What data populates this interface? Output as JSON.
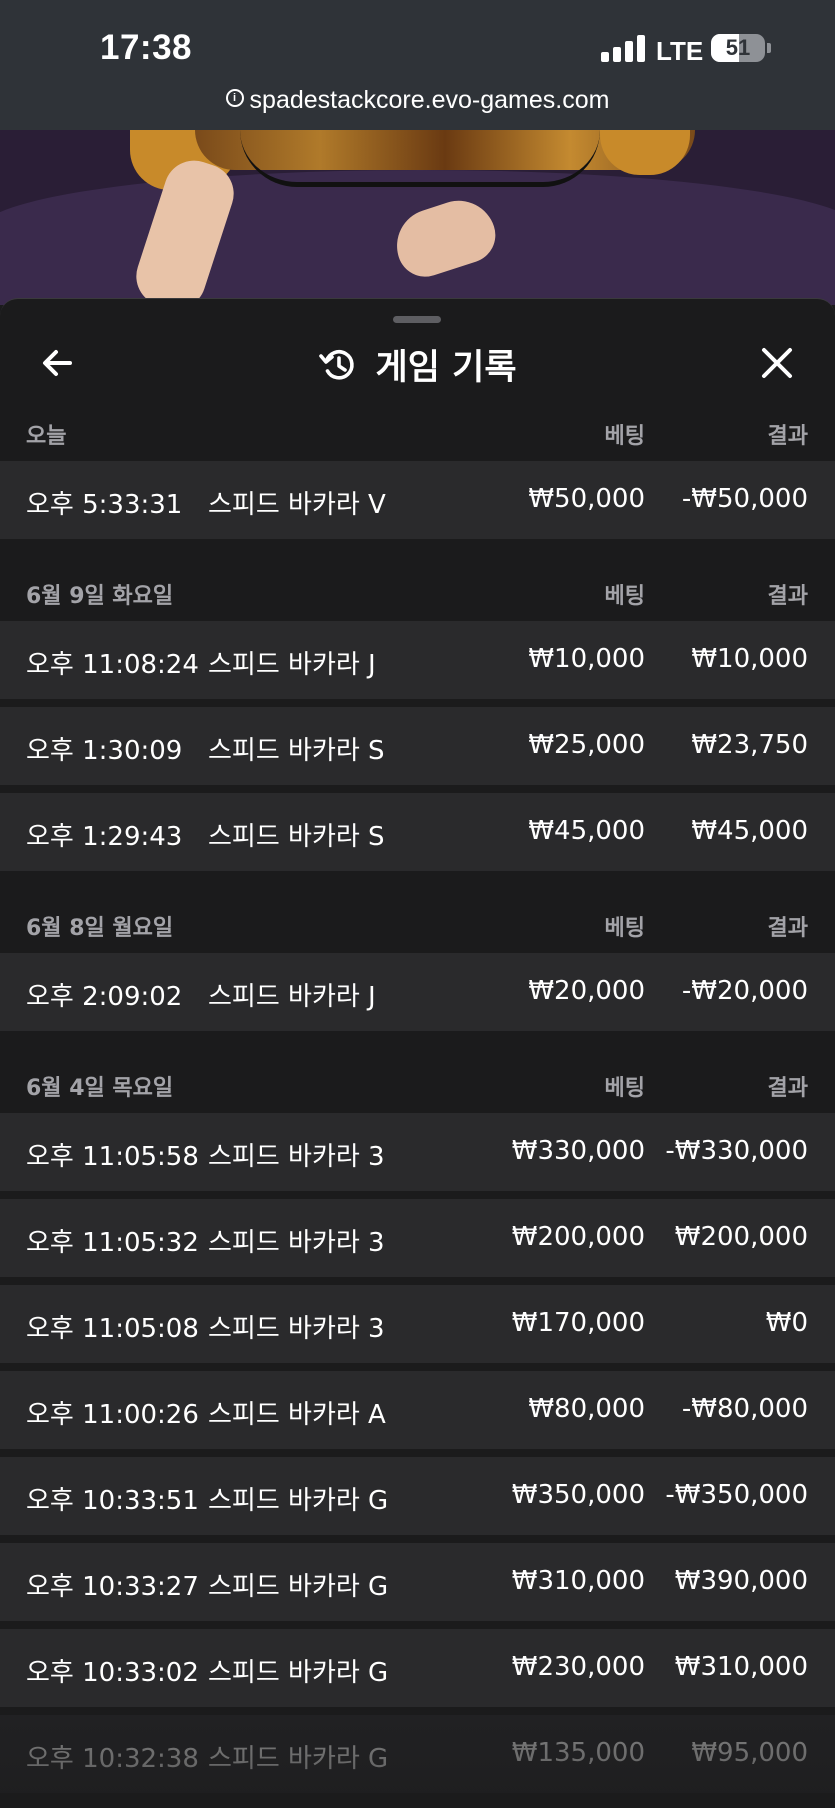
{
  "status_bar": {
    "time": "17:38",
    "network": "LTE",
    "battery": "51",
    "battery_fraction": 0.51
  },
  "browser": {
    "url": "spadestackcore.evo-games.com",
    "info_icon": "info-icon"
  },
  "header": {
    "title": "게임 기록",
    "back_icon": "arrow-left-icon",
    "history_icon": "history-icon",
    "close_icon": "close-icon"
  },
  "columns": {
    "bet": "베팅",
    "result": "결과"
  },
  "groups": [
    {
      "date": "오늘",
      "rows": [
        {
          "time": "오후 5:33:31",
          "game": "스피드 바카라 V",
          "bet": "₩50,000",
          "result": "-₩50,000"
        }
      ]
    },
    {
      "date": "6월 9일 화요일",
      "rows": [
        {
          "time": "오후 11:08:24",
          "game": "스피드 바카라 J",
          "bet": "₩10,000",
          "result": "₩10,000"
        },
        {
          "time": "오후 1:30:09",
          "game": "스피드 바카라 S",
          "bet": "₩25,000",
          "result": "₩23,750"
        },
        {
          "time": "오후 1:29:43",
          "game": "스피드 바카라 S",
          "bet": "₩45,000",
          "result": "₩45,000"
        }
      ]
    },
    {
      "date": "6월 8일 월요일",
      "rows": [
        {
          "time": "오후 2:09:02",
          "game": "스피드 바카라 J",
          "bet": "₩20,000",
          "result": "-₩20,000"
        }
      ]
    },
    {
      "date": "6월 4일 목요일",
      "rows": [
        {
          "time": "오후 11:05:58",
          "game": "스피드 바카라 3",
          "bet": "₩330,000",
          "result": "-₩330,000"
        },
        {
          "time": "오후 11:05:32",
          "game": "스피드 바카라 3",
          "bet": "₩200,000",
          "result": "₩200,000"
        },
        {
          "time": "오후 11:05:08",
          "game": "스피드 바카라 3",
          "bet": "₩170,000",
          "result": "₩0"
        },
        {
          "time": "오후 11:00:26",
          "game": "스피드 바카라 A",
          "bet": "₩80,000",
          "result": "-₩80,000"
        },
        {
          "time": "오후 10:33:51",
          "game": "스피드 바카라 G",
          "bet": "₩350,000",
          "result": "-₩350,000"
        },
        {
          "time": "오후 10:33:27",
          "game": "스피드 바카라 G",
          "bet": "₩310,000",
          "result": "₩390,000"
        },
        {
          "time": "오후 10:33:02",
          "game": "스피드 바카라 G",
          "bet": "₩230,000",
          "result": "₩310,000"
        },
        {
          "time": "오후 10:32:38",
          "game": "스피드 바카라 G",
          "bet": "₩135,000",
          "result": "₩95,000"
        }
      ]
    }
  ]
}
